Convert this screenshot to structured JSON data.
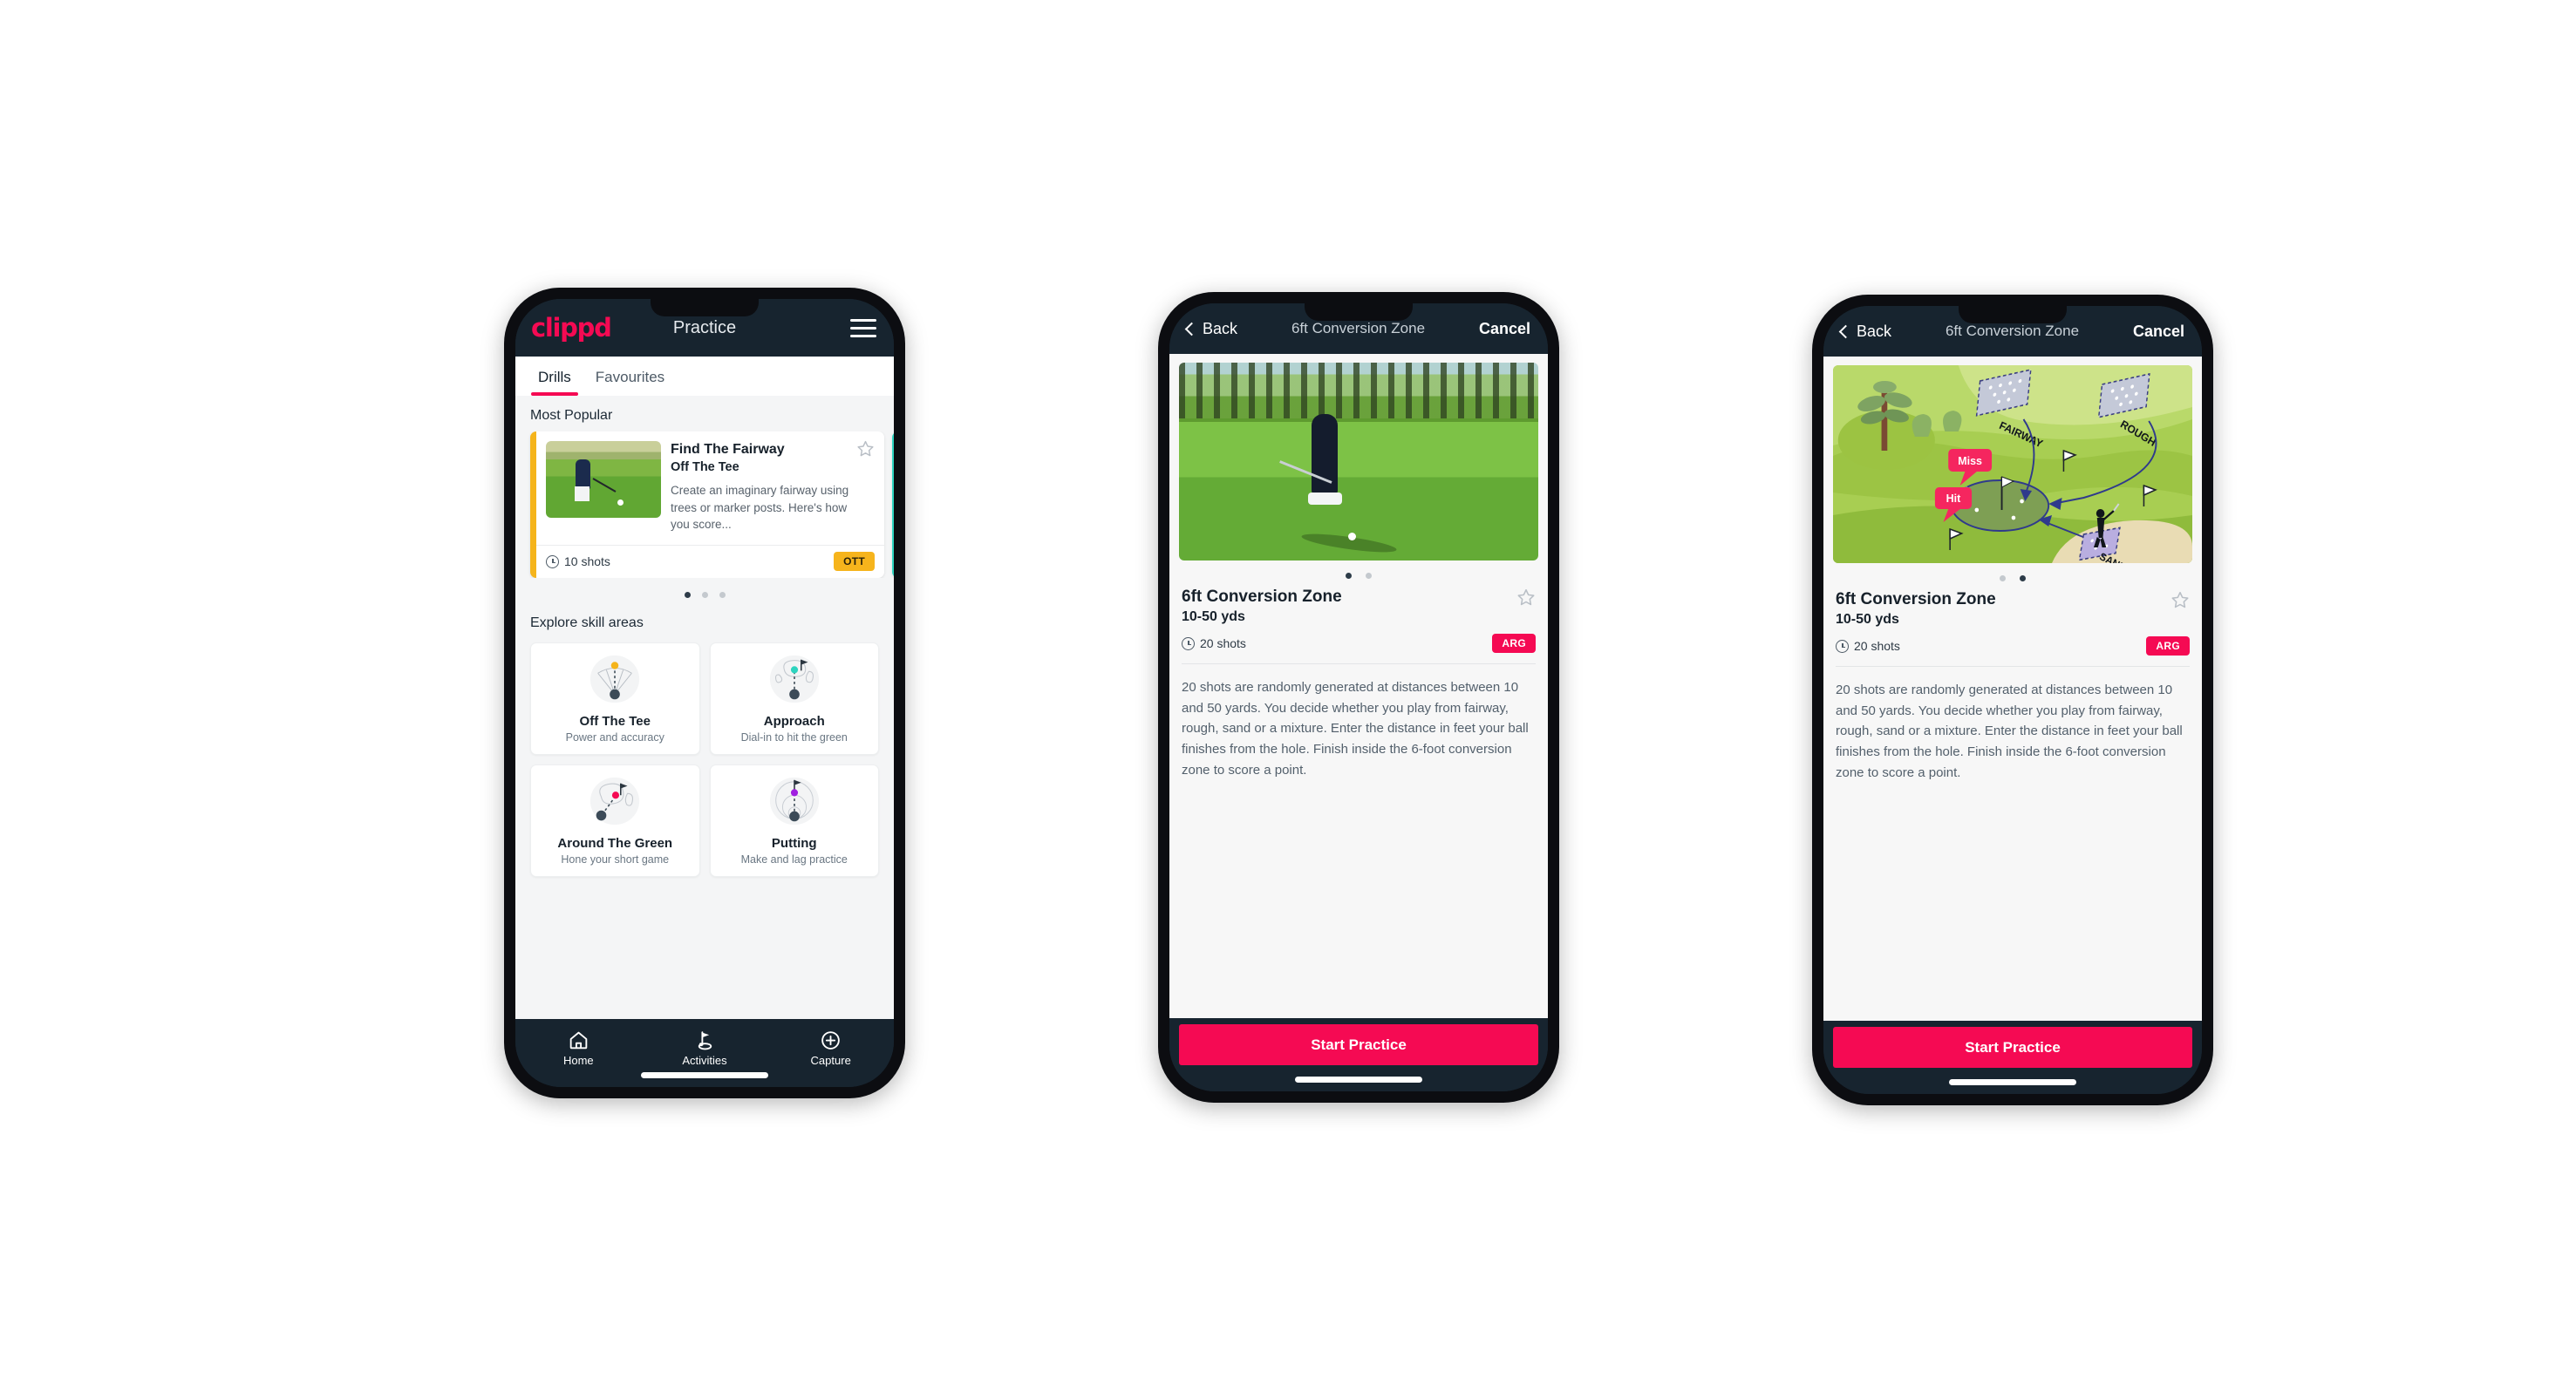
{
  "app": {
    "brand": "clippd",
    "accent": "#f50a53",
    "dark": "#17242f"
  },
  "phone1": {
    "appbar": {
      "title": "Practice",
      "menu_icon": "hamburger-menu-icon"
    },
    "tabs": [
      {
        "label": "Drills",
        "active": true
      },
      {
        "label": "Favourites",
        "active": false
      }
    ],
    "most_popular": {
      "section_title": "Most Popular",
      "card": {
        "title": "Find The Fairway",
        "category": "Off The Tee",
        "description": "Create an imaginary fairway using trees or marker posts. Here's how you score...",
        "shots": "10 shots",
        "badge": "OTT",
        "badge_color": "#f6b41c",
        "accent_color": "#f5b41b",
        "next_accent_color": "#2dd4bf",
        "star_icon": "star-outline-icon"
      },
      "dots": {
        "count": 3,
        "active_index": 0
      }
    },
    "skills": {
      "section_title": "Explore skill areas",
      "items": [
        {
          "name": "Off The Tee",
          "sub": "Power and accuracy",
          "icon": "tee-fan-icon",
          "dot_color": "#f5b41b"
        },
        {
          "name": "Approach",
          "sub": "Dial-in to hit the green",
          "icon": "green-approach-icon",
          "dot_color": "#2dd4bf"
        },
        {
          "name": "Around The Green",
          "sub": "Hone your short game",
          "icon": "chip-green-icon",
          "dot_color": "#f50a53"
        },
        {
          "name": "Putting",
          "sub": "Make and lag practice",
          "icon": "putting-rings-icon",
          "dot_color": "#a020e0"
        }
      ]
    },
    "nav": [
      {
        "label": "Home",
        "icon": "home-icon",
        "active": false
      },
      {
        "label": "Activities",
        "icon": "golf-flag-icon",
        "active": true
      },
      {
        "label": "Capture",
        "icon": "plus-circle-icon",
        "active": false
      }
    ]
  },
  "phone2": {
    "appbar": {
      "back": "Back",
      "title": "6ft Conversion Zone",
      "cancel": "Cancel",
      "back_icon": "chevron-left-icon"
    },
    "media": {
      "kind": "photo",
      "alt": "golfer-chipping-photo"
    },
    "dots": {
      "count": 2,
      "active_index": 0
    },
    "detail": {
      "title": "6ft Conversion Zone",
      "yards": "10-50 yds",
      "shots": "20 shots",
      "badge": "ARG",
      "badge_color": "#f50a53",
      "star_icon": "star-outline-icon",
      "description": "20 shots are randomly generated at distances between 10 and 50 yards. You decide whether you play from fairway, rough, sand or a mixture. Enter the distance in feet your ball finishes from the hole. Finish inside the 6-foot conversion zone to score a point."
    },
    "cta": "Start Practice"
  },
  "phone3": {
    "appbar": {
      "back": "Back",
      "title": "6ft Conversion Zone",
      "cancel": "Cancel",
      "back_icon": "chevron-left-icon"
    },
    "media": {
      "kind": "illustration",
      "alt": "golf-course-diagram",
      "labels": {
        "fairway": "FAIRWAY",
        "rough": "ROUGH",
        "sand": "SAND",
        "miss": "Miss",
        "hit": "Hit"
      }
    },
    "dots": {
      "count": 2,
      "active_index": 1
    },
    "detail": {
      "title": "6ft Conversion Zone",
      "yards": "10-50 yds",
      "shots": "20 shots",
      "badge": "ARG",
      "badge_color": "#f50a53",
      "star_icon": "star-outline-icon",
      "description": "20 shots are randomly generated at distances between 10 and 50 yards. You decide whether you play from fairway, rough, sand or a mixture. Enter the distance in feet your ball finishes from the hole. Finish inside the 6-foot conversion zone to score a point."
    },
    "cta": "Start Practice"
  }
}
